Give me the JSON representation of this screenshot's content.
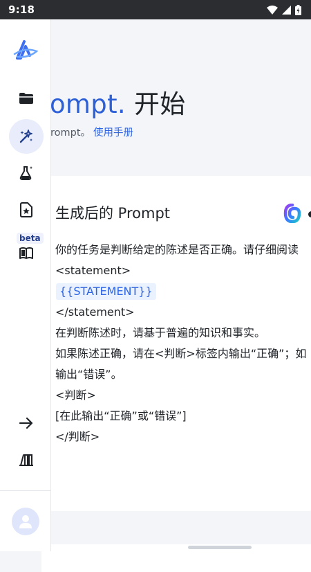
{
  "status_bar": {
    "time": "9:18"
  },
  "hero": {
    "title_accent": "ompt.",
    "title_rest": " 开始",
    "subtitle_text": "rompt。",
    "subtitle_link": "使用手册"
  },
  "sidebar": {
    "beta_label": "beta",
    "items": [
      {
        "icon": "folder-icon"
      },
      {
        "icon": "magic-wand-icon",
        "active": true
      },
      {
        "icon": "flask-icon"
      },
      {
        "icon": "star-document-icon"
      },
      {
        "icon": "book-icon"
      }
    ],
    "bottom": [
      {
        "icon": "arrow-right-icon"
      },
      {
        "icon": "library-icon"
      }
    ]
  },
  "card": {
    "title": "生成后的 Prompt",
    "lines": [
      "你的任务是判断给定的陈述是否正确。请仔细阅读",
      "<statement>",
      "{{STATEMENT}}",
      "</statement>",
      "在判断陈述时，请基于普遍的知识和事实。",
      "如果陈述正确，请在<判断>标签内输出“正确”；如",
      "输出“错误”。",
      "<判断>",
      "[在此输出“正确”或“错误”]",
      "</判断>"
    ]
  },
  "colors": {
    "accent": "#2d5fd6",
    "link": "#2d64e0",
    "status_bar": "#2b2d31",
    "background": "#f3f5f9"
  }
}
